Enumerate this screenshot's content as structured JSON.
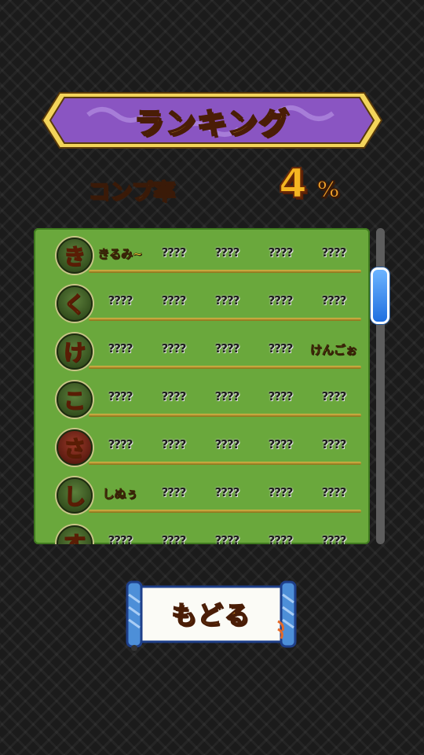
{
  "header": {
    "title": "ランキング"
  },
  "completion": {
    "label": "コンプ率",
    "value": "4",
    "unit": "%"
  },
  "rows": [
    {
      "kana": "き",
      "cells": [
        "きるみ~",
        "????",
        "????",
        "????",
        "????"
      ]
    },
    {
      "kana": "く",
      "cells": [
        "????",
        "????",
        "????",
        "????",
        "????"
      ]
    },
    {
      "kana": "け",
      "cells": [
        "????",
        "????",
        "????",
        "????",
        "けんごぉ"
      ]
    },
    {
      "kana": "こ",
      "cells": [
        "????",
        "????",
        "????",
        "????",
        "????"
      ]
    },
    {
      "kana": "さ",
      "cells": [
        "????",
        "????",
        "????",
        "????",
        "????"
      ]
    },
    {
      "kana": "し",
      "cells": [
        "しぬぅ",
        "????",
        "????",
        "????",
        "????"
      ]
    },
    {
      "kana": "す",
      "cells": [
        "????",
        "????",
        "????",
        "????",
        "????"
      ]
    }
  ],
  "back_button": {
    "label": "もどる"
  },
  "colors": {
    "banner": "#8a55c2",
    "panel": "#6aa83c",
    "accent_gold": "#f5b521",
    "scroll_thumb": "#2a7cf0"
  }
}
